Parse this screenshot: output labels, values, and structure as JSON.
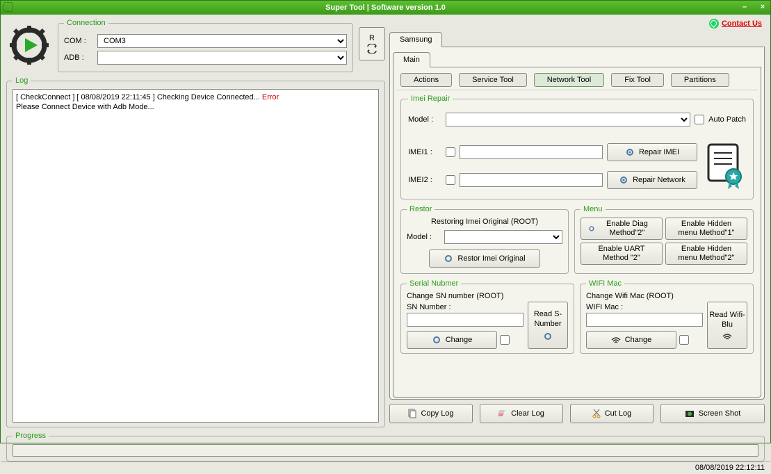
{
  "title": "Super Tool | Software version 1.0",
  "contact": "Contact Us",
  "connection": {
    "legend": "Connection",
    "com_label": "COM :",
    "com_value": "COM3",
    "adb_label": "ADB :",
    "adb_value": "",
    "refresh": "R"
  },
  "log": {
    "legend": "Log",
    "line1_pre": "[ CheckConnect ] [ 08/08/2019 22:11:45 ] Checking Device Connected... ",
    "line1_err": "Error",
    "line2": "Please Connect Device with Adb Mode..."
  },
  "tabs": {
    "device": "Samsung",
    "main": "Main",
    "sub": [
      "Actions",
      "Service Tool",
      "Network Tool",
      "Fix Tool",
      "Partitions"
    ],
    "active_sub": 2
  },
  "imei": {
    "legend": "Imei Repair",
    "model_label": "Model :",
    "auto_patch": "Auto Patch",
    "imei1_label": "IMEI1 :",
    "imei2_label": "IMEI2 :",
    "repair_imei": "Repair IMEI",
    "repair_network": "Repair Network"
  },
  "restor": {
    "legend": "Restor",
    "desc": "Restoring Imei Original (ROOT)",
    "model_label": "Model :",
    "btn": "Restor Imei Original"
  },
  "menu": {
    "legend": "Menu",
    "b1": "Enable Diag Method\"2\"",
    "b2": "Enable Hidden menu Method\"1\"",
    "b3": "Enable UART  Method \"2\"",
    "b4": "Enable Hidden menu Method\"2\""
  },
  "serial": {
    "legend": "Serial Nubmer",
    "desc": "Change SN number (ROOT)",
    "sn_label": "SN Number :",
    "change": "Change",
    "read": "Read S-Number"
  },
  "wifi": {
    "legend": "WIFI Mac",
    "desc": "Change Wifi Mac (ROOT)",
    "mac_label": "WIFI Mac :",
    "change": "Change",
    "read": "Read Wifi-Blu"
  },
  "bottom": {
    "copy": "Copy Log",
    "clear": "Clear Log",
    "cut": "Cut Log",
    "screenshot": "Screen Shot"
  },
  "progress": {
    "legend": "Progress"
  },
  "status_time": "08/08/2019 22:12:11"
}
